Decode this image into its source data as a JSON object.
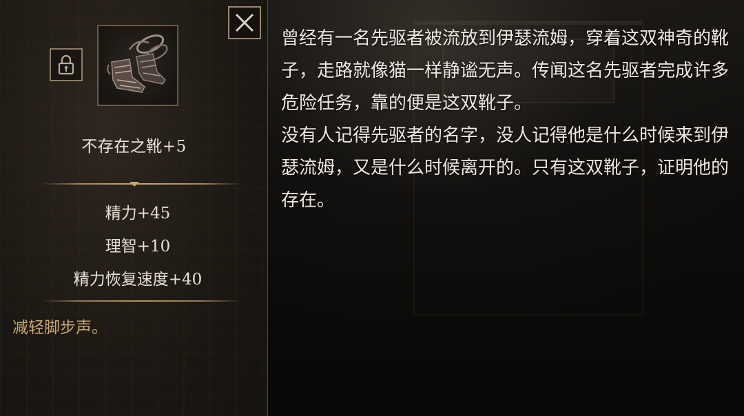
{
  "item": {
    "name": "不存在之靴+5",
    "stats": [
      "精力+45",
      "理智+10",
      "精力恢复速度+40"
    ],
    "effect": "减轻脚步声。",
    "icon": "boots-icon"
  },
  "controls": {
    "close_icon": "close-icon",
    "lock_icon": "lock-icon"
  },
  "description": {
    "paragraphs": [
      "曾经有一名先驱者被流放到伊瑟流姆，穿着这双神奇的靴子，走路就像猫一样静谧无声。传闻这名先驱者完成许多危险任务，靠的便是这双靴子。",
      "没有人记得先驱者的名字，没人记得他是什么时候来到伊瑟流姆，又是什么时候离开的。只有这双靴子，证明他的存在。"
    ]
  },
  "colors": {
    "effect_text": "#c9a66c",
    "divider": "#c8a870",
    "panel_border": "#5c4a36"
  }
}
